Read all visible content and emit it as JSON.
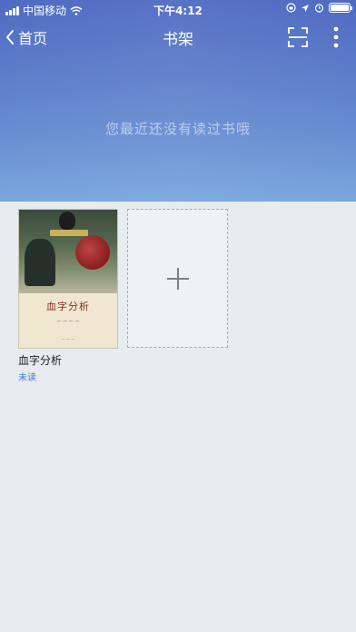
{
  "status_bar": {
    "carrier": "中国移动",
    "time": "下午4:12",
    "battery_level": 1.0
  },
  "nav": {
    "back_label": "首页",
    "title": "书架"
  },
  "empty_message": "您最近还没有读过书哦",
  "books": [
    {
      "cover_title": "血字分析",
      "name": "血字分析",
      "status": "未读",
      "cover_emblem": "Sherlock Holmes"
    }
  ],
  "icons": {
    "back": "chevron-left-icon",
    "scan": "scan-icon",
    "more": "more-vertical-icon",
    "add": "plus-icon",
    "wifi": "wifi-icon",
    "battery": "battery-icon"
  },
  "colors": {
    "hero_top": "#4f6bc2",
    "hero_bottom": "#7aa7dd",
    "shelf_bg": "#e8ebf0",
    "status_link": "#3a7bd5"
  }
}
